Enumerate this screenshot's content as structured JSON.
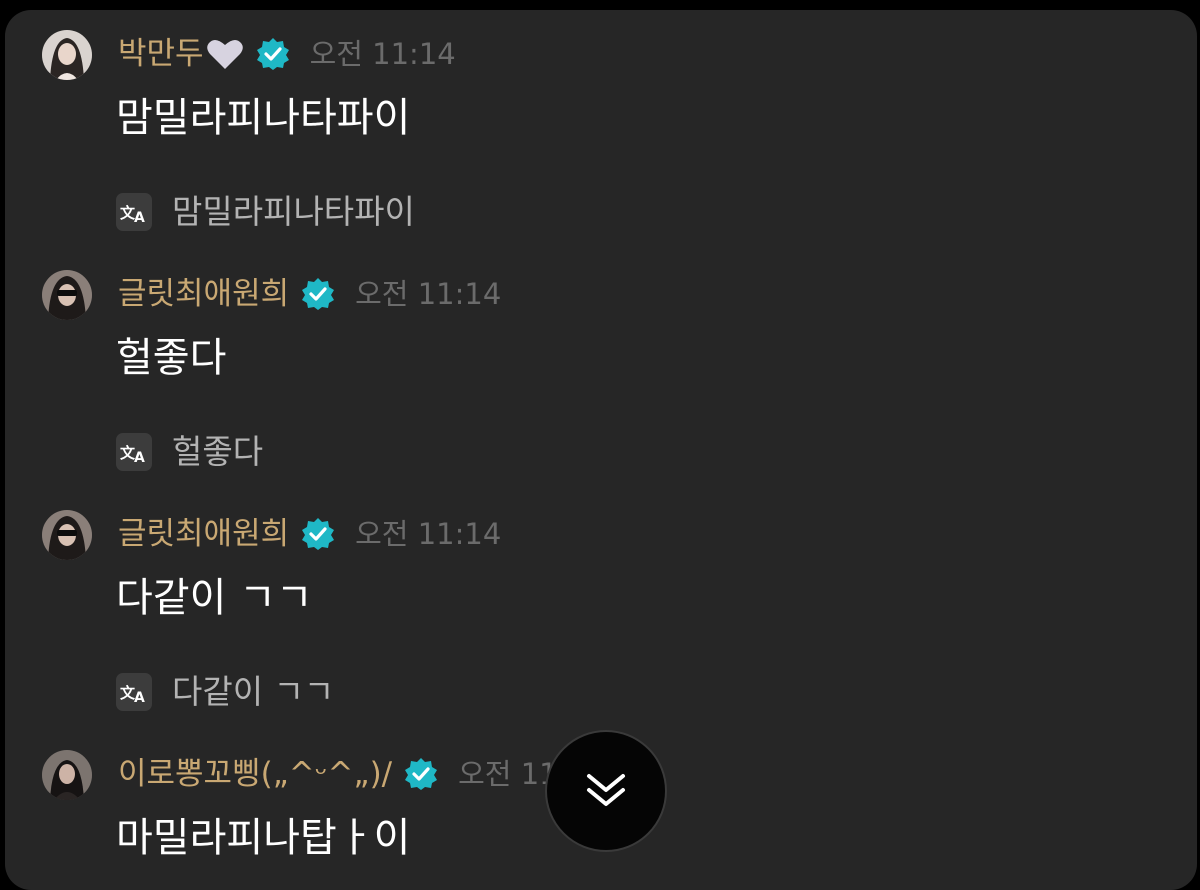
{
  "colors": {
    "background": "#262626",
    "username": "#c9a873",
    "timestamp": "#6b6b6b",
    "message_text": "#ffffff",
    "translation_text": "#b3b3b3",
    "verified_badge": "#1fb8c6"
  },
  "messages": [
    {
      "username": "박만두",
      "username_emoji_icon": "white-heart-icon",
      "verified": true,
      "time": "오전 11:14",
      "text": "맘밀라피나타파이",
      "translation": "맘밀라피나타파이"
    },
    {
      "username": "글릿최애원희",
      "verified": true,
      "time": "오전 11:14",
      "text": "헐좋다",
      "translation": "헐좋다"
    },
    {
      "username": "글릿최애원희",
      "verified": true,
      "time": "오전 11:14",
      "text": "다같이 ㄱㄱ",
      "translation": "다같이 ㄱㄱ"
    },
    {
      "username": "이로뽕꼬삥(„^ᵕ^„)/",
      "verified": true,
      "time": "오전 11:14",
      "text": "마밀라피나탑ㅏ이"
    }
  ],
  "icons": {
    "translate": "translate-icon",
    "verified": "verified-badge-icon",
    "scroll_down": "double-chevron-down-icon"
  }
}
